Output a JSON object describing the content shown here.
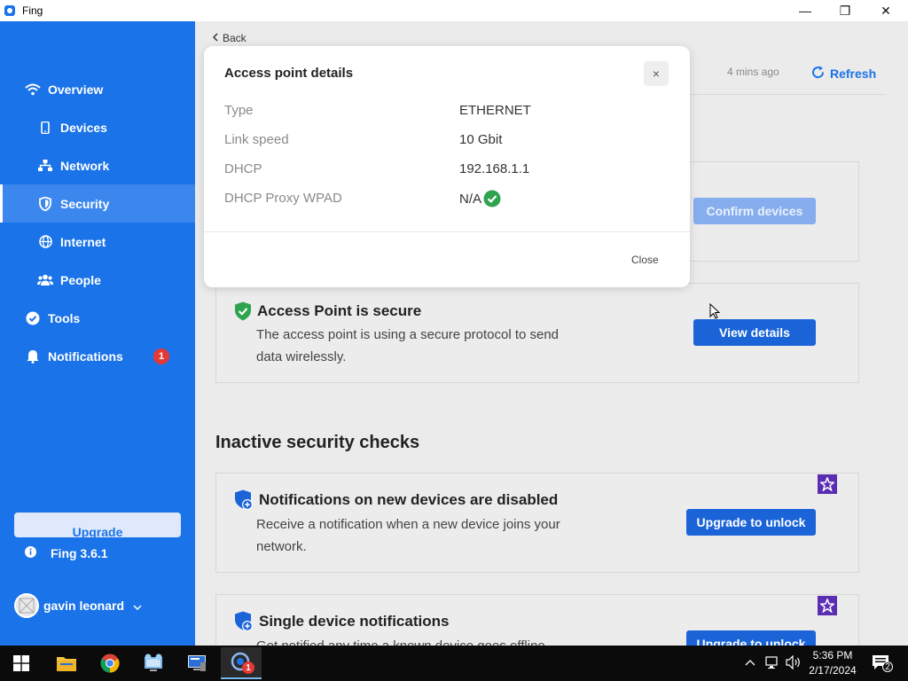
{
  "window": {
    "title": "Fing",
    "minimize": "—",
    "maximize": "❐",
    "close": "✕"
  },
  "sidebar": {
    "items": [
      {
        "label": "Overview",
        "icon": "wifi-icon"
      },
      {
        "label": "Devices",
        "icon": "phone-icon"
      },
      {
        "label": "Network",
        "icon": "network-icon"
      },
      {
        "label": "Security",
        "icon": "shield-icon",
        "active": true
      },
      {
        "label": "Internet",
        "icon": "globe-icon"
      },
      {
        "label": "People",
        "icon": "people-icon"
      },
      {
        "label": "Tools",
        "icon": "check-circle-icon"
      },
      {
        "label": "Notifications",
        "icon": "bell-icon",
        "badge": "1"
      }
    ],
    "upgrade_label": "Upgrade",
    "version": "Fing 3.6.1",
    "user_name": "gavin leonard"
  },
  "main": {
    "back_label": "Back",
    "last_updated": "4 mins ago",
    "refresh_label": "Refresh",
    "confirm_button": "Confirm devices",
    "secure_card": {
      "title": "Access Point is secure",
      "description": "The access point is using a secure protocol to send data wirelessly.",
      "button": "View details"
    },
    "inactive_title": "Inactive security checks",
    "inactive_cards": [
      {
        "title": "Notifications on new devices are disabled",
        "description": "Receive a notification when a new device joins your network.",
        "button": "Upgrade to unlock"
      },
      {
        "title": "Single device notifications",
        "description": "Get notified any time a known device goes offline",
        "button": "Upgrade to unlock"
      }
    ]
  },
  "modal": {
    "title": "Access point details",
    "close_x": "×",
    "rows": [
      {
        "label": "Type",
        "value": "ETHERNET"
      },
      {
        "label": "Link speed",
        "value": "10 Gbit"
      },
      {
        "label": "DHCP",
        "value": "192.168.1.1"
      },
      {
        "label": "DHCP Proxy WPAD",
        "value": "N/A"
      }
    ],
    "close_label": "Close"
  },
  "taskbar": {
    "time": "5:36 PM",
    "date": "2/17/2024",
    "notification_count": "2",
    "fing_badge": "1"
  },
  "colors": {
    "accent": "#1a73e8",
    "success": "#2ea44f",
    "premium": "#5b2db3"
  }
}
